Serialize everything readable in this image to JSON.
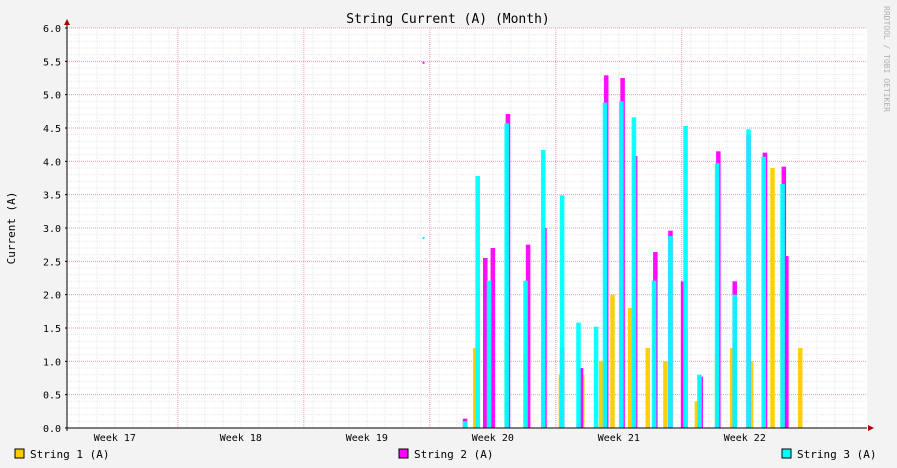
{
  "chart_data": {
    "type": "area",
    "title": "String Current (A) (Month)",
    "ylabel": "Current (A)",
    "xlabel": "",
    "watermark": "RRDTOOL / TOBI OETIKER",
    "ylim": [
      0,
      6
    ],
    "yticks": [
      "0.0",
      "0.5",
      "1.0",
      "1.5",
      "2.0",
      "2.5",
      "3.0",
      "3.5",
      "4.0",
      "4.5",
      "5.0",
      "5.5",
      "6.0"
    ],
    "xlim_weeks": [
      16.62,
      22.97
    ],
    "xticks": [
      {
        "label": "Week 17",
        "week": 17
      },
      {
        "label": "Week 18",
        "week": 18
      },
      {
        "label": "Week 19",
        "week": 19
      },
      {
        "label": "Week 20",
        "week": 20
      },
      {
        "label": "Week 21",
        "week": 21
      },
      {
        "label": "Week 22",
        "week": 22
      }
    ],
    "grid": true,
    "legend_position": "bottom",
    "colors": {
      "background": "#f3f3f3",
      "canvas": "#ffffff",
      "major_grid": "#e6a0b4",
      "minor_grid": "#e8e8e8",
      "axis": "#000000",
      "arrow": "#b00000"
    },
    "series": [
      {
        "name": "String 1 (A)",
        "color": "#ffcc00",
        "points": [
          [
            19.78,
            0.11
          ],
          [
            19.86,
            1.2
          ],
          [
            19.96,
            1.5
          ],
          [
            20.11,
            1.3
          ],
          [
            20.26,
            1.1
          ],
          [
            20.4,
            1.3
          ],
          [
            20.54,
            0.8
          ],
          [
            20.71,
            0.8
          ],
          [
            20.86,
            1.0
          ],
          [
            20.95,
            2.0
          ],
          [
            21.09,
            1.8
          ],
          [
            21.23,
            1.2
          ],
          [
            21.37,
            1.0
          ],
          [
            21.53,
            1.5
          ],
          [
            21.62,
            0.4
          ],
          [
            21.78,
            1.1
          ],
          [
            21.9,
            1.2
          ],
          [
            22.05,
            1.0
          ],
          [
            22.22,
            3.9
          ],
          [
            22.3,
            2.6
          ],
          [
            22.44,
            1.2
          ]
        ]
      },
      {
        "name": "String 2 (A)",
        "color": "#ff00ff",
        "points": [
          [
            19.78,
            0.14
          ],
          [
            19.94,
            2.55
          ],
          [
            20.0,
            2.7
          ],
          [
            20.12,
            4.71
          ],
          [
            20.28,
            2.75
          ],
          [
            20.41,
            3.0
          ],
          [
            20.55,
            1.2
          ],
          [
            20.7,
            0.9
          ],
          [
            20.9,
            5.29
          ],
          [
            21.03,
            5.25
          ],
          [
            21.13,
            4.08
          ],
          [
            21.29,
            2.64
          ],
          [
            21.41,
            2.96
          ],
          [
            21.51,
            2.2
          ],
          [
            21.65,
            0.77
          ],
          [
            21.79,
            4.15
          ],
          [
            21.92,
            2.2
          ],
          [
            22.03,
            4.4
          ],
          [
            22.16,
            4.13
          ],
          [
            22.31,
            3.92
          ],
          [
            22.33,
            2.58
          ],
          [
            19.45,
            5.48
          ]
        ]
      },
      {
        "name": "String 3 (A)",
        "color": "#00ffff",
        "points": [
          [
            19.78,
            0.1
          ],
          [
            19.88,
            3.78
          ],
          [
            19.97,
            2.21
          ],
          [
            20.11,
            4.57
          ],
          [
            20.26,
            2.21
          ],
          [
            20.4,
            4.17
          ],
          [
            20.55,
            3.49
          ],
          [
            20.68,
            1.58
          ],
          [
            20.82,
            1.52
          ],
          [
            20.89,
            4.88
          ],
          [
            21.02,
            4.9
          ],
          [
            21.12,
            4.66
          ],
          [
            21.28,
            2.21
          ],
          [
            21.41,
            2.88
          ],
          [
            21.53,
            4.53
          ],
          [
            21.64,
            0.8
          ],
          [
            21.78,
            3.97
          ],
          [
            21.92,
            2.0
          ],
          [
            22.03,
            4.48
          ],
          [
            22.15,
            4.07
          ],
          [
            22.3,
            3.66
          ],
          [
            19.45,
            2.85
          ]
        ]
      }
    ]
  }
}
